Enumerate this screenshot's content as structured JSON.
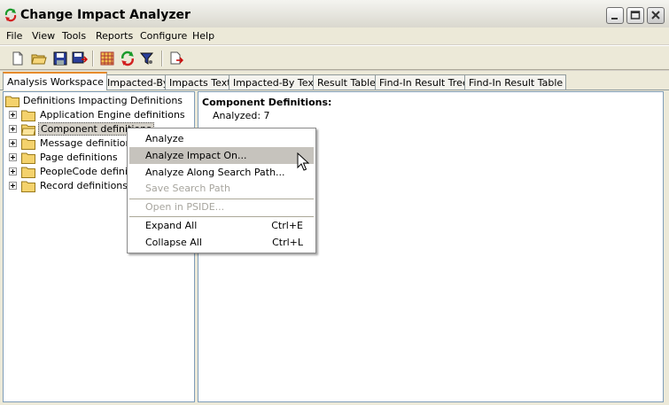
{
  "window": {
    "title": "Change Impact Analyzer",
    "icon": "refresh-arrows-icon"
  },
  "menubar": [
    "File",
    "View",
    "Tools",
    "Reports",
    "Configure",
    "Help"
  ],
  "toolbar": {
    "icons": [
      "new-file-icon",
      "open-folder-icon",
      "save-icon",
      "save-as-icon",
      "grid-table-icon",
      "refresh-icon",
      "filter-funnel-icon",
      "export-icon"
    ]
  },
  "tabs": [
    {
      "label": "Analysis Workspace",
      "active": true
    },
    {
      "label": "Impacted-By",
      "active": false
    },
    {
      "label": "Impacts Text",
      "active": false
    },
    {
      "label": "Impacted-By Text",
      "active": false
    },
    {
      "label": "Result Table",
      "active": false
    },
    {
      "label": "Find-In Result Tree",
      "active": false
    },
    {
      "label": "Find-In Result Table",
      "active": false
    }
  ],
  "tree": {
    "root": "Definitions Impacting Definitions",
    "items": [
      "Application Engine definitions",
      "Component definitions",
      "Message definitions",
      "Page definitions",
      "PeopleCode definitions",
      "Record definitions"
    ]
  },
  "details": {
    "heading": "Component Definitions:",
    "analyzed": "Analyzed: 7"
  },
  "context_menu": [
    {
      "label": "Analyze",
      "shortcut": "",
      "disabled": false,
      "hover": false
    },
    {
      "label": "Analyze Impact On...",
      "shortcut": "",
      "disabled": false,
      "hover": true
    },
    {
      "label": "Analyze Along Search Path...",
      "shortcut": "",
      "disabled": false,
      "hover": false
    },
    {
      "label": "Save Search Path",
      "shortcut": "",
      "disabled": true,
      "hover": false
    },
    {
      "label": "Open in PSIDE...",
      "shortcut": "",
      "disabled": true,
      "hover": false
    },
    {
      "label": "Expand All",
      "shortcut": "Ctrl+E",
      "disabled": false,
      "hover": false
    },
    {
      "label": "Collapse All",
      "shortcut": "Ctrl+L",
      "disabled": false,
      "hover": false
    }
  ],
  "colors": {
    "titlebar": "#e8e7e0",
    "chrome": "#ece9d8",
    "menu_hover": "#c6c3bd",
    "tab_active_accent": "#e68b2c",
    "pane_border": "#7f9db9"
  }
}
